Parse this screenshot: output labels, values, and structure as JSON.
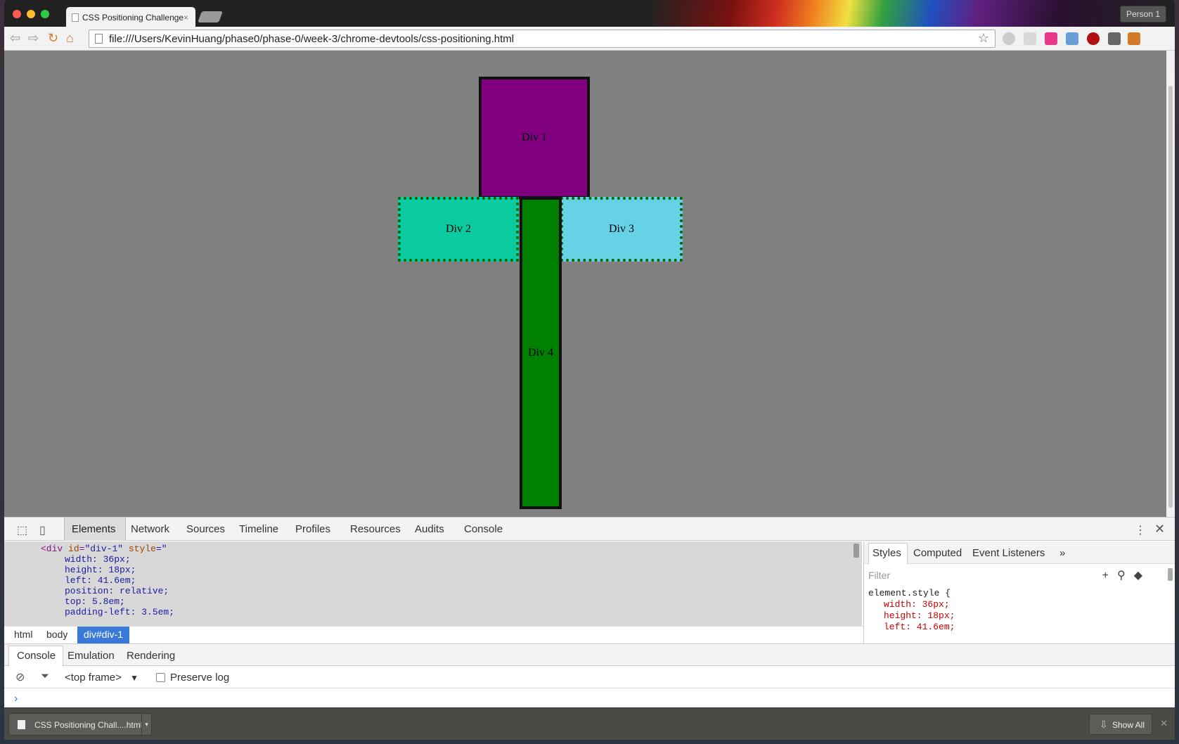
{
  "browser": {
    "tab_title": "CSS Positioning Challenge",
    "tab_close": "×",
    "profile": "Person 1",
    "url": "file:///Users/KevinHuang/phase0/phase-0/week-3/chrome-devtools/css-positioning.html"
  },
  "page": {
    "div1": "Div 1",
    "div2": "Div 2",
    "div3": "Div 3",
    "div4": "Div 4"
  },
  "devtools": {
    "tabs": [
      "Elements",
      "Network",
      "Sources",
      "Timeline",
      "Profiles",
      "Resources",
      "Audits",
      "Console"
    ],
    "active_tab": "Elements",
    "element_open": "<div",
    "element_id_attr": "id",
    "element_id_val": "\"div-1\"",
    "element_style_attr": "style",
    "element_style_open": "=\"",
    "element_lines": [
      "width: 36px;",
      "height: 18px;",
      "left: 41.6em;",
      "position: relative;",
      "top: 5.8em;",
      "padding-left: 3.5em;"
    ],
    "breadcrumbs": [
      "html",
      "body",
      "div#div-1"
    ],
    "styles_tabs": [
      "Styles",
      "Computed",
      "Event Listeners",
      "»"
    ],
    "filter_placeholder": "Filter",
    "style_selector": "element.style {",
    "style_props": [
      "width: 36px;",
      "height: 18px;",
      "left: 41.6em;"
    ],
    "drawer_tabs": [
      "Console",
      "Emulation",
      "Rendering"
    ],
    "frame_select": "<top frame>",
    "preserve_log": "Preserve log",
    "prompt": "›"
  },
  "downloads": {
    "file": "CSS Positioning Chall....html",
    "show_all": "Show All"
  },
  "colors": {
    "div1": "#800080",
    "div2": "#0acca0",
    "div3": "#66d2e6",
    "div4": "#008000",
    "page_bg": "#808080"
  }
}
